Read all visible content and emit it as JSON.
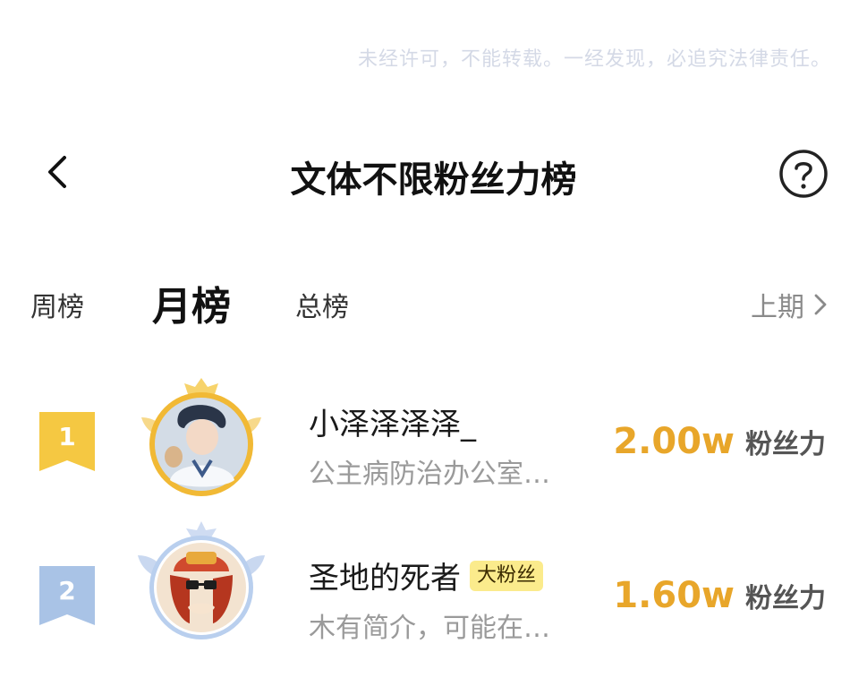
{
  "watermark": "未经许可，不能转载。一经发现，必追究法律责任。",
  "header": {
    "title": "文体不限粉丝力榜"
  },
  "tabs": [
    {
      "label": "周榜",
      "active": false
    },
    {
      "label": "月榜",
      "active": true
    },
    {
      "label": "总榜",
      "active": false
    }
  ],
  "prev_period": "上期",
  "ranking": [
    {
      "rank": "1",
      "name": "小泽泽泽泽_",
      "tag": "",
      "bio": "公主病防治办公室…",
      "score": "2.00w",
      "unit": "粉丝力",
      "badge_color": "#f5c842",
      "frame_color": "#f1b935"
    },
    {
      "rank": "2",
      "name": "圣地的死者",
      "tag": "大粉丝",
      "bio": "木有简介，可能在…",
      "score": "1.60w",
      "unit": "粉丝力",
      "badge_color": "#a9c3e6",
      "frame_color": "#b9cfee"
    }
  ],
  "colors": {
    "score": "#e8a62a",
    "tag_bg": "#fbeb8c"
  }
}
